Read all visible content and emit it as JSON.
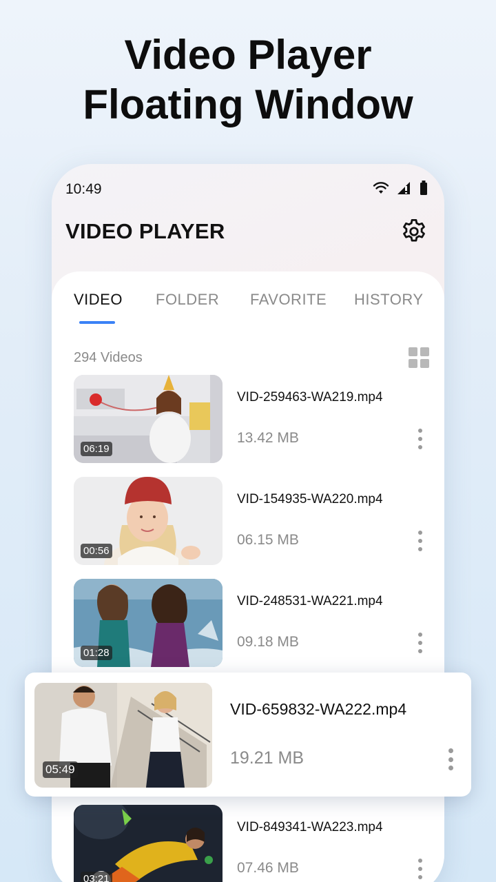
{
  "headline": {
    "line1": "Video Player",
    "line2": "Floating Window"
  },
  "status_bar": {
    "time": "10:49"
  },
  "header": {
    "title": "VIDEO PLAYER"
  },
  "tabs": [
    {
      "label": "VIDEO",
      "active": true
    },
    {
      "label": "FOLDER",
      "active": false
    },
    {
      "label": "FAVORITE",
      "active": false
    },
    {
      "label": "HISTORY",
      "active": false
    }
  ],
  "video_count": "294 Videos",
  "videos": [
    {
      "name": "VID-259463-WA219.mp4",
      "size": "13.42 MB",
      "duration": "06:19"
    },
    {
      "name": "VID-154935-WA220.mp4",
      "size": "06.15 MB",
      "duration": "00:56"
    },
    {
      "name": "VID-248531-WA221.mp4",
      "size": "09.18 MB",
      "duration": "01:28"
    },
    {
      "name": "VID-659832-WA222.mp4",
      "size": "19.21 MB",
      "duration": "05:49",
      "floating": true
    },
    {
      "name": "VID-849341-WA223.mp4",
      "size": "07.46 MB",
      "duration": "03:21"
    }
  ],
  "colors": {
    "accent": "#3b82f6",
    "text": "#111111",
    "muted": "#8a8a8a"
  },
  "icons": [
    "wifi-icon",
    "signal-icon",
    "battery-icon",
    "settings-gear-icon",
    "grid-view-icon",
    "more-vertical-icon"
  ]
}
